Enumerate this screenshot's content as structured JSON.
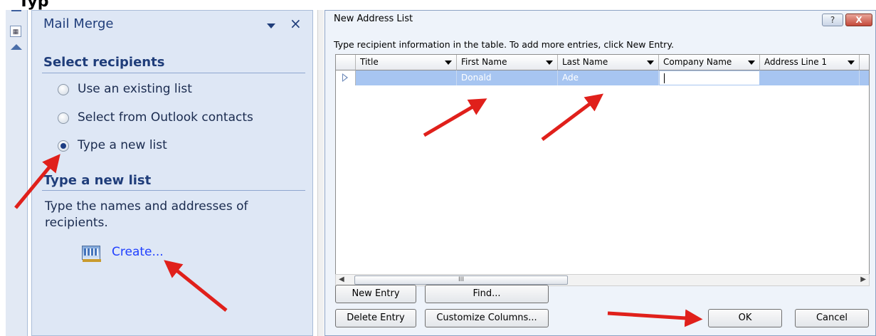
{
  "heading_fragment": "Typ",
  "task_pane": {
    "title": "Mail Merge",
    "section1": "Select recipients",
    "options": [
      {
        "label": "Use an existing list",
        "selected": false
      },
      {
        "label": "Select from Outlook contacts",
        "selected": false
      },
      {
        "label": "Type a new list",
        "selected": true
      }
    ],
    "section2": "Type a new list",
    "description": "Type the names and addresses of recipients.",
    "create_link": "Create..."
  },
  "dialog": {
    "title": "New Address List",
    "help": "?",
    "close": "X",
    "instruction": "Type recipient information in the table.  To add more entries, click New Entry.",
    "columns": [
      "Title",
      "First Name",
      "Last Name",
      "Company Name",
      "Address Line 1"
    ],
    "row": {
      "title": "",
      "first_name": "Donald",
      "last_name": "Ade",
      "company_name": "",
      "address_line_1": ""
    },
    "scroll_thumb": "III",
    "buttons": {
      "new_entry": "New Entry",
      "find": "Find...",
      "delete_entry": "Delete Entry",
      "customize_columns": "Customize Columns...",
      "ok": "OK",
      "cancel": "Cancel"
    }
  },
  "colors": {
    "annotation_arrow": "#e0201b",
    "pane_bg": "#dee7f5",
    "selected_row": "#a7c5f1",
    "link": "#1f3fff"
  }
}
